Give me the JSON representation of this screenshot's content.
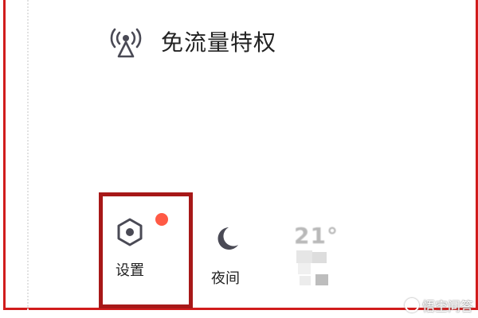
{
  "feature": {
    "label": "免流量特权",
    "icon": "broadcast-signal-icon"
  },
  "toolbar": {
    "settings": {
      "label": "设置",
      "icon": "hexagon-settings-icon",
      "badge_color": "#ff5a45"
    },
    "night": {
      "label": "夜间",
      "icon": "moon-icon"
    },
    "weather": {
      "temperature": "21°"
    }
  },
  "watermark": {
    "text": "悟空问答"
  },
  "colors": {
    "annotation_red": "#d11c1c",
    "highlight_red": "#a71818",
    "icon_gray": "#4a4a55"
  }
}
